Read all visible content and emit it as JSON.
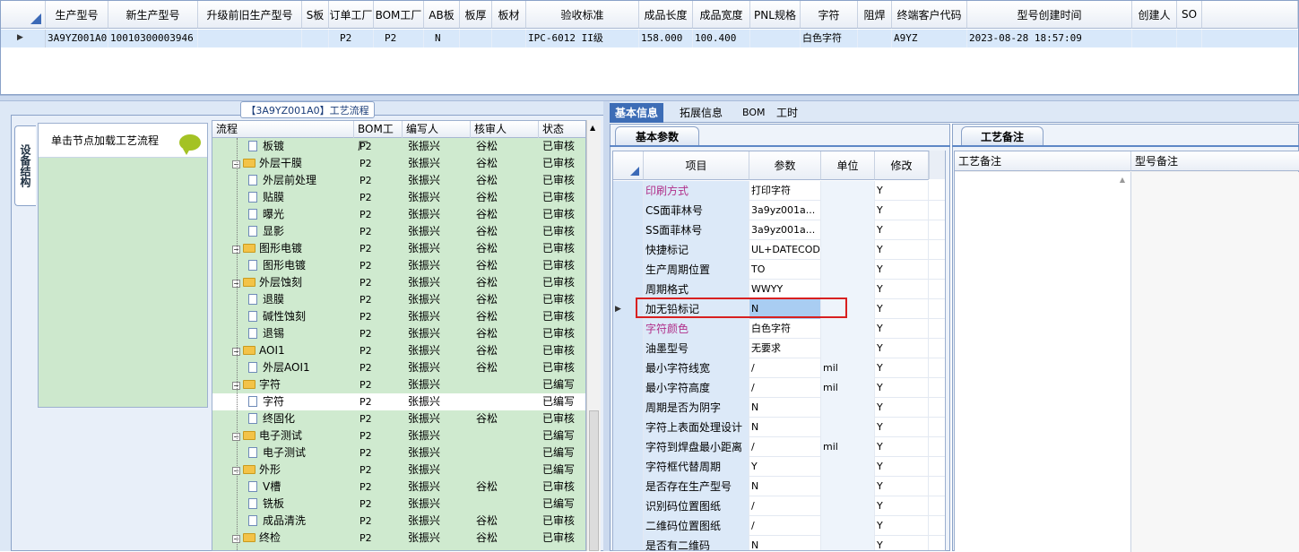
{
  "top_grid": {
    "headers": [
      "生产型号",
      "新生产型号",
      "升级前旧生产型号",
      "S板",
      "订单工厂",
      "BOM工厂",
      "AB板",
      "板厚",
      "板材",
      "验收标准",
      "成品长度",
      "成品宽度",
      "PNL规格",
      "字符",
      "阻焊",
      "终端客户代码",
      "型号创建时间",
      "创建人",
      "SO"
    ],
    "row": [
      "3A9YZ001A0",
      "10010300003946",
      "",
      "",
      "P2",
      "P2",
      "N",
      "",
      "",
      "IPC-6012 II级",
      "158.000",
      "100.400",
      "",
      "白色字符",
      "",
      "A9YZ",
      "2023-08-28 18:57:09",
      "",
      ""
    ]
  },
  "left": {
    "vertical_tab": "设备结构",
    "node_hint": "单击节点加载工艺流程",
    "flow_title": "【3A9YZ001A0】工艺流程",
    "tree_headers": [
      "流程",
      "BOM工厂",
      "编写人",
      "核审人",
      "状态"
    ],
    "tree_rows": [
      {
        "name": "板镀",
        "level": 2,
        "type": "doc",
        "bom": "P2",
        "writer": "张振兴",
        "checker": "谷松",
        "status": "已审核"
      },
      {
        "name": "外层干膜",
        "level": 1,
        "type": "folder",
        "bom": "P2",
        "writer": "张振兴",
        "checker": "谷松",
        "status": "已审核"
      },
      {
        "name": "外层前处理",
        "level": 2,
        "type": "doc",
        "bom": "P2",
        "writer": "张振兴",
        "checker": "谷松",
        "status": "已审核"
      },
      {
        "name": "贴膜",
        "level": 2,
        "type": "doc",
        "bom": "P2",
        "writer": "张振兴",
        "checker": "谷松",
        "status": "已审核"
      },
      {
        "name": "曝光",
        "level": 2,
        "type": "doc",
        "bom": "P2",
        "writer": "张振兴",
        "checker": "谷松",
        "status": "已审核"
      },
      {
        "name": "显影",
        "level": 2,
        "type": "doc",
        "bom": "P2",
        "writer": "张振兴",
        "checker": "谷松",
        "status": "已审核"
      },
      {
        "name": "图形电镀",
        "level": 1,
        "type": "folder",
        "bom": "P2",
        "writer": "张振兴",
        "checker": "谷松",
        "status": "已审核"
      },
      {
        "name": "图形电镀",
        "level": 2,
        "type": "doc",
        "bom": "P2",
        "writer": "张振兴",
        "checker": "谷松",
        "status": "已审核"
      },
      {
        "name": "外层蚀刻",
        "level": 1,
        "type": "folder",
        "bom": "P2",
        "writer": "张振兴",
        "checker": "谷松",
        "status": "已审核"
      },
      {
        "name": "退膜",
        "level": 2,
        "type": "doc",
        "bom": "P2",
        "writer": "张振兴",
        "checker": "谷松",
        "status": "已审核"
      },
      {
        "name": "碱性蚀刻",
        "level": 2,
        "type": "doc",
        "bom": "P2",
        "writer": "张振兴",
        "checker": "谷松",
        "status": "已审核"
      },
      {
        "name": "退锡",
        "level": 2,
        "type": "doc",
        "bom": "P2",
        "writer": "张振兴",
        "checker": "谷松",
        "status": "已审核"
      },
      {
        "name": "AOI1",
        "level": 1,
        "type": "folder",
        "bom": "P2",
        "writer": "张振兴",
        "checker": "谷松",
        "status": "已审核"
      },
      {
        "name": "外层AOI1",
        "level": 2,
        "type": "doc",
        "bom": "P2",
        "writer": "张振兴",
        "checker": "谷松",
        "status": "已审核"
      },
      {
        "name": "字符",
        "level": 1,
        "type": "folder",
        "bom": "P2",
        "writer": "张振兴",
        "checker": "",
        "status": "已编写"
      },
      {
        "name": "字符",
        "level": 2,
        "type": "doc",
        "bom": "P2",
        "writer": "张振兴",
        "checker": "",
        "status": "已编写",
        "selected": true
      },
      {
        "name": "终固化",
        "level": 2,
        "type": "doc",
        "bom": "P2",
        "writer": "张振兴",
        "checker": "谷松",
        "status": "已审核"
      },
      {
        "name": "电子测试",
        "level": 1,
        "type": "folder",
        "bom": "P2",
        "writer": "张振兴",
        "checker": "",
        "status": "已编写"
      },
      {
        "name": "电子测试",
        "level": 2,
        "type": "doc",
        "bom": "P2",
        "writer": "张振兴",
        "checker": "",
        "status": "已编写"
      },
      {
        "name": "外形",
        "level": 1,
        "type": "folder",
        "bom": "P2",
        "writer": "张振兴",
        "checker": "",
        "status": "已编写"
      },
      {
        "name": "V槽",
        "level": 2,
        "type": "doc",
        "bom": "P2",
        "writer": "张振兴",
        "checker": "谷松",
        "status": "已审核"
      },
      {
        "name": "铣板",
        "level": 2,
        "type": "doc",
        "bom": "P2",
        "writer": "张振兴",
        "checker": "",
        "status": "已编写"
      },
      {
        "name": "成品清洗",
        "level": 2,
        "type": "doc",
        "bom": "P2",
        "writer": "张振兴",
        "checker": "谷松",
        "status": "已审核"
      },
      {
        "name": "终检",
        "level": 1,
        "type": "folder",
        "bom": "P2",
        "writer": "张振兴",
        "checker": "谷松",
        "status": "已审核"
      }
    ]
  },
  "right": {
    "tabs": [
      "基本信息",
      "拓展信息",
      "BOM",
      "工时"
    ],
    "basic_tab": "基本参数",
    "remark_tab": "工艺备注",
    "param_headers": [
      "项目",
      "参数",
      "单位",
      "修改"
    ],
    "params": [
      {
        "item": "印刷方式",
        "value": "打印字符",
        "unit": "",
        "modify": "Y",
        "highlight": true
      },
      {
        "item": "CS面菲林号",
        "value": "3a9yz001a...",
        "unit": "",
        "modify": "Y"
      },
      {
        "item": "SS面菲林号",
        "value": "3a9yz001a...",
        "unit": "",
        "modify": "Y"
      },
      {
        "item": "快捷标记",
        "value": "UL+DATECODE",
        "unit": "",
        "modify": "Y"
      },
      {
        "item": "生产周期位置",
        "value": "TO",
        "unit": "",
        "modify": "Y"
      },
      {
        "item": "周期格式",
        "value": "WWYY",
        "unit": "",
        "modify": "Y"
      },
      {
        "item": "加无铅标记",
        "value": "N",
        "unit": "",
        "modify": "Y",
        "current": true
      },
      {
        "item": "字符颜色",
        "value": "白色字符",
        "unit": "",
        "modify": "Y",
        "highlight": true
      },
      {
        "item": "油墨型号",
        "value": "无要求",
        "unit": "",
        "modify": "Y"
      },
      {
        "item": "最小字符线宽",
        "value": "/",
        "unit": "mil",
        "modify": "Y"
      },
      {
        "item": "最小字符高度",
        "value": "/",
        "unit": "mil",
        "modify": "Y"
      },
      {
        "item": "周期是否为阴字",
        "value": "N",
        "unit": "",
        "modify": "Y"
      },
      {
        "item": "字符上表面处理设计",
        "value": "N",
        "unit": "",
        "modify": "Y"
      },
      {
        "item": "字符到焊盘最小距离",
        "value": "/",
        "unit": "mil",
        "modify": "Y"
      },
      {
        "item": "字符框代替周期",
        "value": "Y",
        "unit": "",
        "modify": "Y"
      },
      {
        "item": "是否存在生产型号",
        "value": "N",
        "unit": "",
        "modify": "Y"
      },
      {
        "item": "识别码位置图纸",
        "value": "/",
        "unit": "",
        "modify": "Y"
      },
      {
        "item": "二维码位置图纸",
        "value": "/",
        "unit": "",
        "modify": "Y"
      },
      {
        "item": "是否有二维码",
        "value": "N",
        "unit": "",
        "modify": "Y"
      }
    ],
    "remark_headers": [
      "工艺备注",
      "型号备注"
    ]
  }
}
